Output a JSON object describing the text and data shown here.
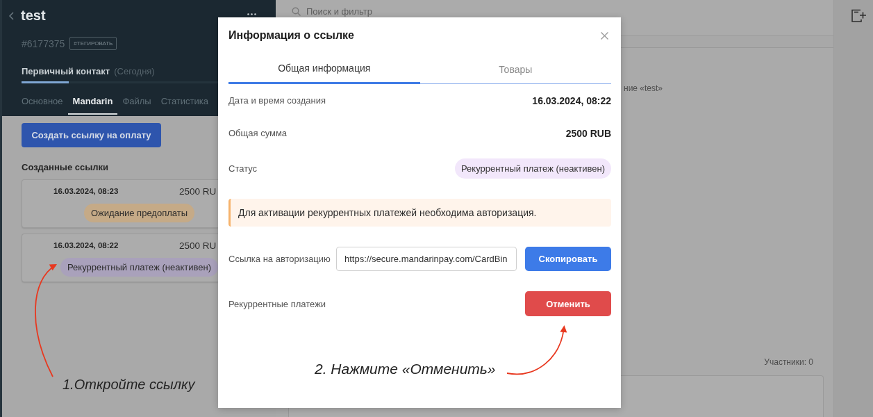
{
  "left_panel": {
    "title": "test",
    "id": "#6177375",
    "tag_button": "#ТЕГИРОВАТЬ",
    "stage": {
      "name": "Первичный контакт",
      "date": "(Сегодня)",
      "level": 0.24
    },
    "tabs": [
      {
        "label": "Основное",
        "selected": false
      },
      {
        "label": "Mandarin",
        "selected": true
      },
      {
        "label": "Файлы",
        "selected": false
      },
      {
        "label": "Статистика",
        "selected": false
      }
    ],
    "create_button": "Создать ссылку на оплату",
    "links_heading": "Созданные ссылки",
    "links": [
      {
        "date": "16.03.2024, 08:23",
        "amount": "2500 RU",
        "status": "Ожидание предоплаты",
        "color": "#c5aa87"
      },
      {
        "date": "16.03.2024, 08:22",
        "amount": "2500 RU",
        "status": "Рекуррентный платеж (неактивен)",
        "color": "#a9a1bb"
      }
    ]
  },
  "main": {
    "search": {
      "placeholder": "Поиск и фильтр"
    },
    "feed_text": "ние «test»",
    "participants": "Участники: 0"
  },
  "modal": {
    "title": "Информация о ссылке",
    "tabs": [
      {
        "label": "Общая информация",
        "selected": true
      },
      {
        "label": "Товары",
        "selected": false
      }
    ],
    "fields": [
      {
        "label": "Дата и время создания",
        "kind": "text",
        "value": "16.03.2024, 08:22"
      },
      {
        "label": "Общая сумма",
        "kind": "text",
        "value": "2500 RUB"
      },
      {
        "label": "Статус",
        "kind": "badge",
        "value": "Рекуррентный платеж (неактивен)"
      }
    ],
    "alert": "Для активации рекуррентных платежей необходима авторизация.",
    "auth_link": {
      "label": "Ссылка на авторизацию",
      "value": "https://secure.mandarinpay.com/CardBin",
      "button": "Скопировать"
    },
    "recurring": {
      "label": "Рекуррентные платежи",
      "button": "Отменить"
    }
  },
  "annotations": [
    {
      "text": "1.Откройте ссылку"
    },
    {
      "text": "2. Нажмите «Отменить»"
    }
  ]
}
